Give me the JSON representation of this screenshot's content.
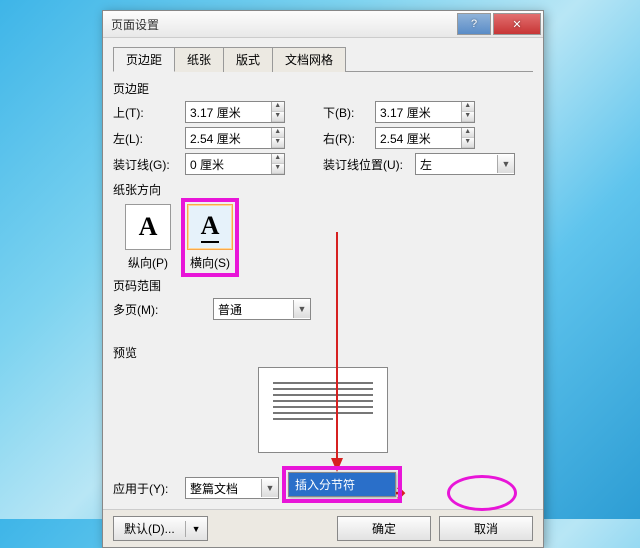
{
  "title": "页面设置",
  "tabs": [
    "页边距",
    "纸张",
    "版式",
    "文档网格"
  ],
  "section_margins": "页边距",
  "top_label": "上(T):",
  "top_val": "3.17 厘米",
  "bottom_label": "下(B):",
  "bottom_val": "3.17 厘米",
  "left_label": "左(L):",
  "left_val": "2.54 厘米",
  "right_label": "右(R):",
  "right_val": "2.54 厘米",
  "gutter_label": "装订线(G):",
  "gutter_val": "0 厘米",
  "gutterpos_label": "装订线位置(U):",
  "gutterpos_val": "左",
  "section_orient": "纸张方向",
  "portrait_label": "纵向(P)",
  "landscape_label": "横向(S)",
  "section_pages": "页码范围",
  "multi_label": "多页(M):",
  "multi_val": "普通",
  "section_preview": "预览",
  "apply_label": "应用于(Y):",
  "apply_val": "整篇文档",
  "default_btn": "默认(D)...",
  "ok_btn": "确定",
  "cancel_btn": "取消",
  "menu_item": "插入分节符"
}
